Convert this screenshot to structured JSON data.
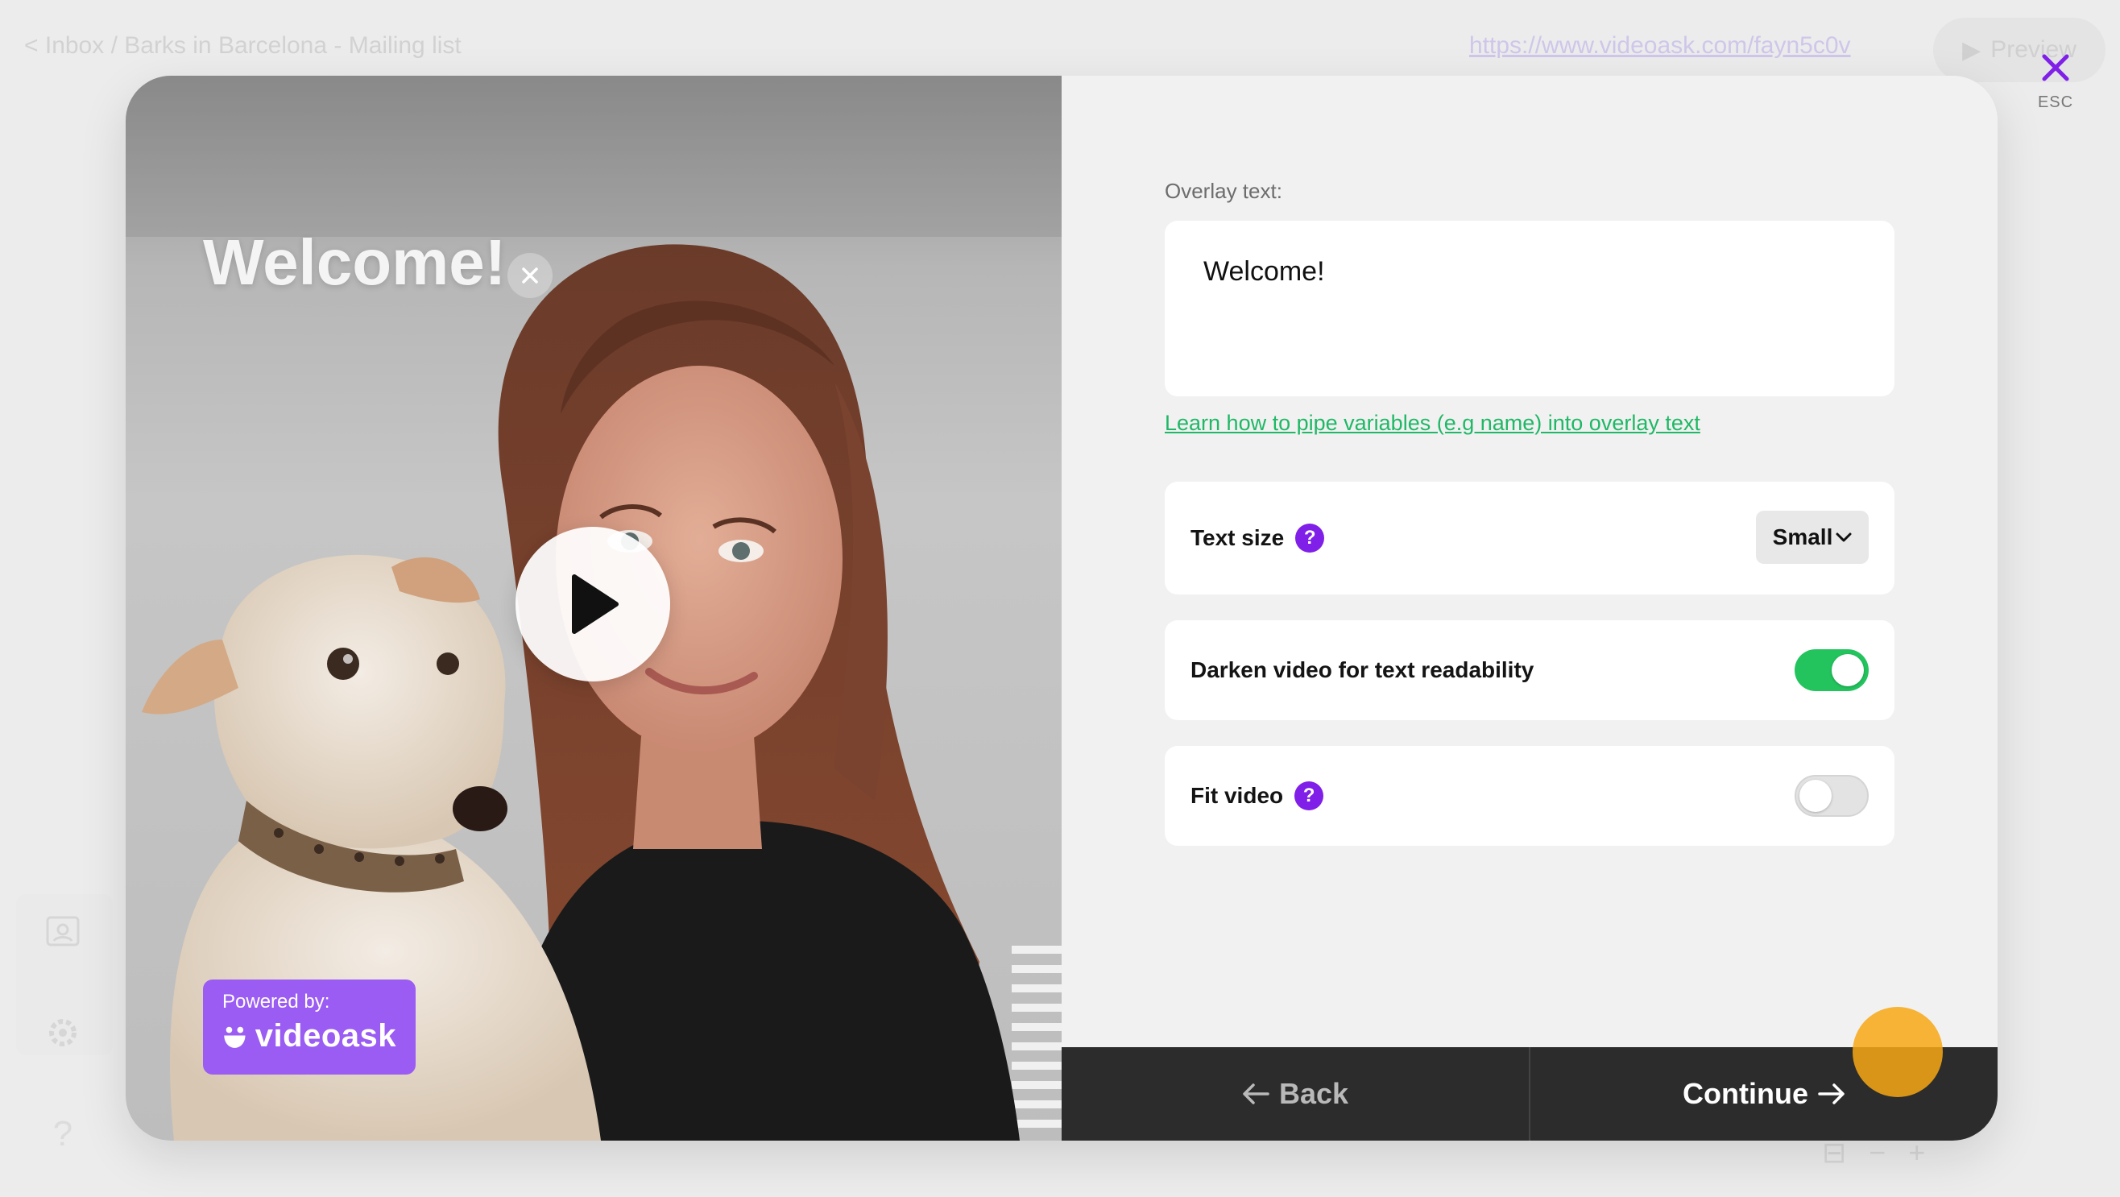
{
  "background": {
    "breadcrumb": "< Inbox / Barks in Barcelona - Mailing list",
    "share_url": "https://www.videoask.com/fayn5c0v",
    "preview_label": "Preview"
  },
  "modal": {
    "close_hint": "ESC",
    "video": {
      "overlay_text": "Welcome!",
      "powered_by_label": "Powered by:",
      "brand_name": "videoask",
      "brand_color": "#9a5cf2"
    },
    "settings": {
      "overlay_label": "Overlay text:",
      "overlay_value": "Welcome!",
      "learn_link": "Learn how to pipe variables (e.g name) into overlay text",
      "text_size": {
        "label": "Text size",
        "value": "Small"
      },
      "darken": {
        "label": "Darken video for text readability",
        "enabled": true
      },
      "fit": {
        "label": "Fit video",
        "enabled": false
      }
    },
    "footer": {
      "back_label": "Back",
      "continue_label": "Continue"
    }
  },
  "colors": {
    "accent_purple": "#7f1fe8",
    "toggle_on": "#23c45e",
    "link_green": "#1fb866",
    "footer_bg": "#2c2c2c"
  }
}
